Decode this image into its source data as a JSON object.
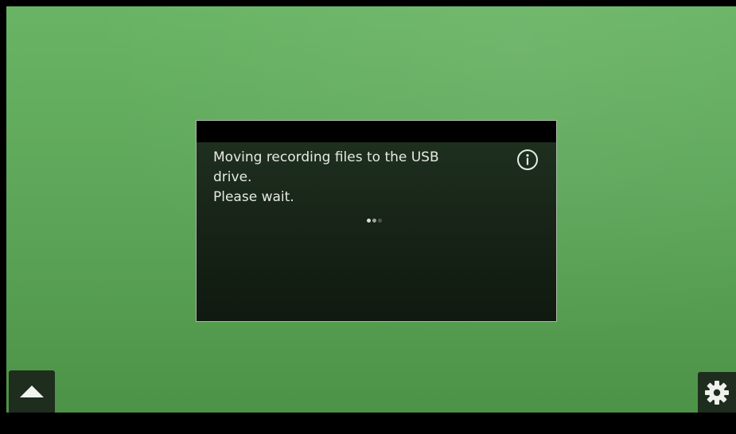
{
  "dialog": {
    "message": "Moving recording files to the USB\ndrive.\nPlease wait.",
    "info_icon": "info-icon",
    "spinner_icon": "loading-dots-icon"
  },
  "controls": {
    "expand_icon": "triangle-up-icon",
    "settings_icon": "gear-icon"
  },
  "colors": {
    "background": "#5fa85a",
    "dialog_bg": "#172417",
    "dialog_text": "#e6eae4",
    "button_bg": "#1f2d1f"
  }
}
